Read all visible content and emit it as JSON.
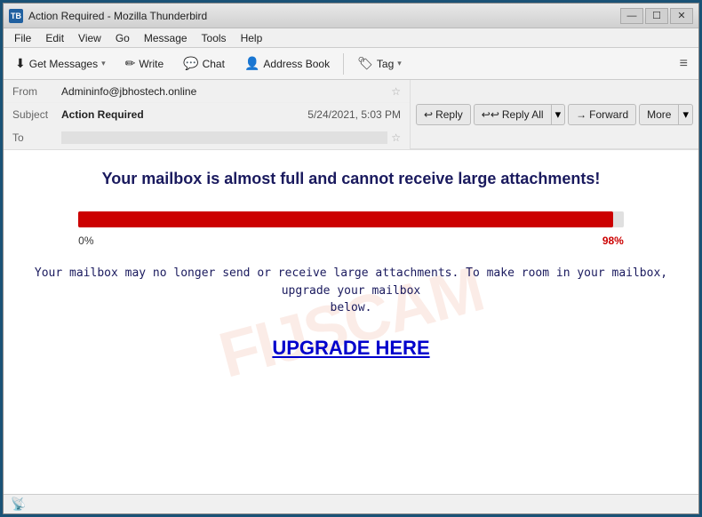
{
  "window": {
    "title": "Action Required - Mozilla Thunderbird",
    "icon": "TB"
  },
  "title_controls": {
    "minimize": "—",
    "maximize": "☐",
    "close": "✕"
  },
  "menu": {
    "items": [
      "File",
      "Edit",
      "View",
      "Go",
      "Message",
      "Tools",
      "Help"
    ]
  },
  "toolbar": {
    "get_messages_label": "Get Messages",
    "write_label": "Write",
    "chat_label": "Chat",
    "address_book_label": "Address Book",
    "tag_label": "Tag",
    "menu_icon": "≡"
  },
  "email_actions": {
    "reply_label": "Reply",
    "reply_all_label": "Reply All",
    "forward_label": "Forward",
    "more_label": "More"
  },
  "email_header": {
    "from_label": "From",
    "from_value": "Admininfo@jbhostech.online",
    "subject_label": "Subject",
    "subject_value": "Action Required",
    "to_label": "To",
    "to_value": "",
    "timestamp": "5/24/2021, 5:03 PM"
  },
  "email_body": {
    "heading": "Your mailbox is almost full and cannot receive large attachments!",
    "progress_start": "0%",
    "progress_end": "98%",
    "warning_text": "Your mailbox may no longer send or receive large attachments. To make room in your mailbox, upgrade your mailbox\nbelow.",
    "upgrade_text": "UPGRADE HERE",
    "watermark": "FIJSCAM"
  },
  "status_bar": {
    "icon": "📡"
  }
}
